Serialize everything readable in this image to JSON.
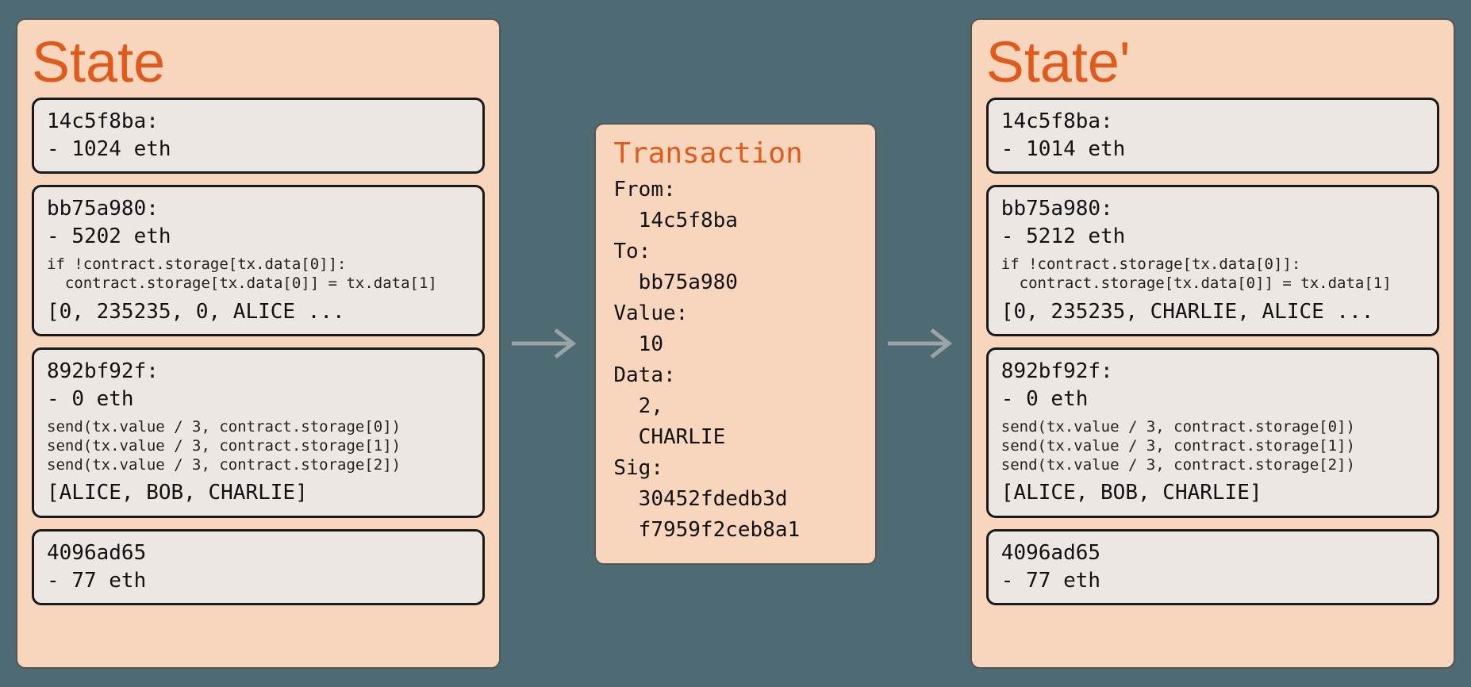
{
  "state_before": {
    "title": "State",
    "accounts": [
      {
        "addr": "14c5f8ba",
        "balance": "1024 eth"
      },
      {
        "addr": "bb75a980",
        "balance": "5202 eth",
        "code": "if !contract.storage[tx.data[0]]:\n  contract.storage[tx.data[0]] = tx.data[1]",
        "storage": "[0, 235235, 0, ALICE ..."
      },
      {
        "addr": "892bf92f",
        "balance": "0 eth",
        "code": "send(tx.value / 3, contract.storage[0])\nsend(tx.value / 3, contract.storage[1])\nsend(tx.value / 3, contract.storage[2])",
        "storage": "[ALICE, BOB, CHARLIE]"
      },
      {
        "addr": "4096ad65",
        "balance": "77 eth"
      }
    ]
  },
  "transaction": {
    "title": "Transaction",
    "from_label": "From:",
    "from": "14c5f8ba",
    "to_label": "To:",
    "to": "bb75a980",
    "value_label": "Value:",
    "value": "10",
    "data_label": "Data:",
    "data": "2,\n  CHARLIE",
    "sig_label": "Sig:",
    "sig": "30452fdedb3d\n  f7959f2ceb8a1"
  },
  "state_after": {
    "title": "State'",
    "accounts": [
      {
        "addr": "14c5f8ba",
        "balance": "1014 eth"
      },
      {
        "addr": "bb75a980",
        "balance": "5212 eth",
        "code": "if !contract.storage[tx.data[0]]:\n  contract.storage[tx.data[0]] = tx.data[1]",
        "storage": "[0, 235235, CHARLIE, ALICE ..."
      },
      {
        "addr": "892bf92f",
        "balance": "0 eth",
        "code": "send(tx.value / 3, contract.storage[0])\nsend(tx.value / 3, contract.storage[1])\nsend(tx.value / 3, contract.storage[2])",
        "storage": "[ALICE, BOB, CHARLIE]"
      },
      {
        "addr": "4096ad65",
        "balance": "77 eth"
      }
    ]
  }
}
